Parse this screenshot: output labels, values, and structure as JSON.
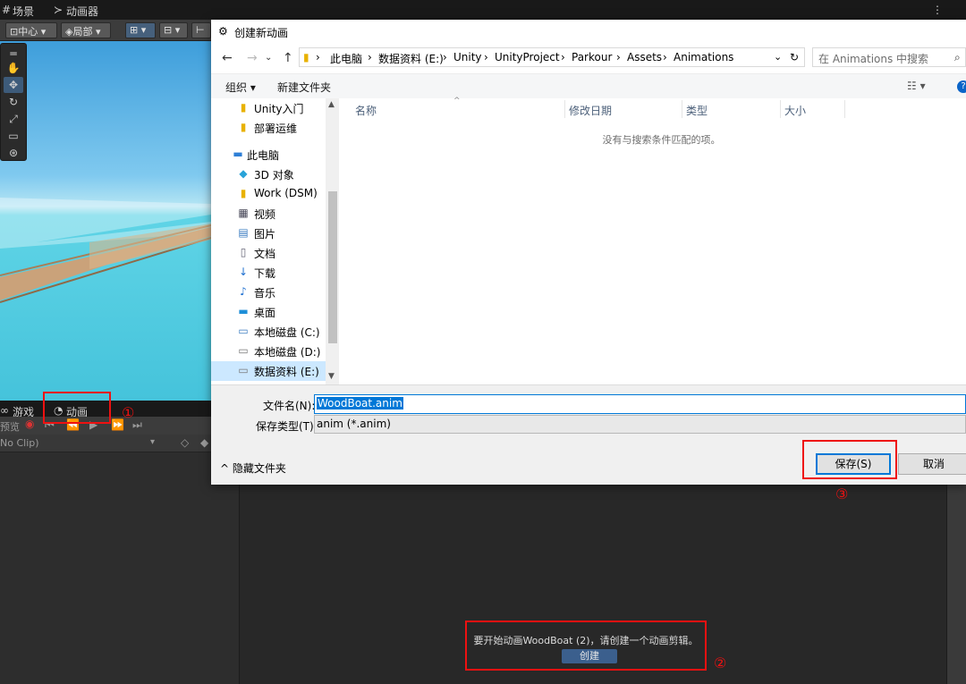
{
  "unity": {
    "top_tabs": {
      "scene": "场景",
      "animator": "动画器"
    },
    "toolbar": {
      "pivot": "中心",
      "local": "局部"
    },
    "bottom_tabs": {
      "game": "游戏",
      "animation": "动画"
    },
    "preview_label": "预览",
    "clip_dropdown": "No Clip)",
    "create_message": "要开始动画WoodBoat (2)，请创建一个动画剪辑。",
    "create_button": "创建"
  },
  "annotations": {
    "marker_1": "①",
    "marker_2": "②",
    "marker_3": "③"
  },
  "dialog": {
    "title": "创建新动画",
    "breadcrumb": [
      "此电脑",
      "数据资料 (E:)",
      "Unity",
      "UnityProject",
      "Parkour",
      "Assets",
      "Animations"
    ],
    "search_placeholder": "在 Animations 中搜索",
    "toolbar": {
      "organize": "组织 ▾",
      "new_folder": "新建文件夹"
    },
    "nav_items": [
      {
        "label": "Unity入门",
        "icon": "folder-icon"
      },
      {
        "label": "部署运维",
        "icon": "folder-icon"
      },
      {
        "label": "此电脑",
        "icon": "computer-icon"
      },
      {
        "label": "3D 对象",
        "icon": "3d-objects-icon"
      },
      {
        "label": "Work (DSM)",
        "icon": "network-drive-icon"
      },
      {
        "label": "视频",
        "icon": "video-icon"
      },
      {
        "label": "图片",
        "icon": "pictures-icon"
      },
      {
        "label": "文档",
        "icon": "documents-icon"
      },
      {
        "label": "下载",
        "icon": "download-icon"
      },
      {
        "label": "音乐",
        "icon": "music-icon"
      },
      {
        "label": "桌面",
        "icon": "desktop-icon"
      },
      {
        "label": "本地磁盘 (C:)",
        "icon": "windows-drive-icon"
      },
      {
        "label": "本地磁盘 (D:)",
        "icon": "drive-icon"
      },
      {
        "label": "数据资料 (E:)",
        "icon": "drive-icon",
        "selected": true
      }
    ],
    "columns": [
      "名称",
      "修改日期",
      "类型",
      "大小"
    ],
    "empty_message": "没有与搜索条件匹配的项。",
    "filename_label": "文件名(N):",
    "filename_value": "WoodBoat.anim",
    "filetype_label": "保存类型(T):",
    "filetype_value": "anim (*.anim)",
    "hide_folders": "隐藏文件夹",
    "save_button": "保存(S)",
    "cancel_button": "取消"
  }
}
